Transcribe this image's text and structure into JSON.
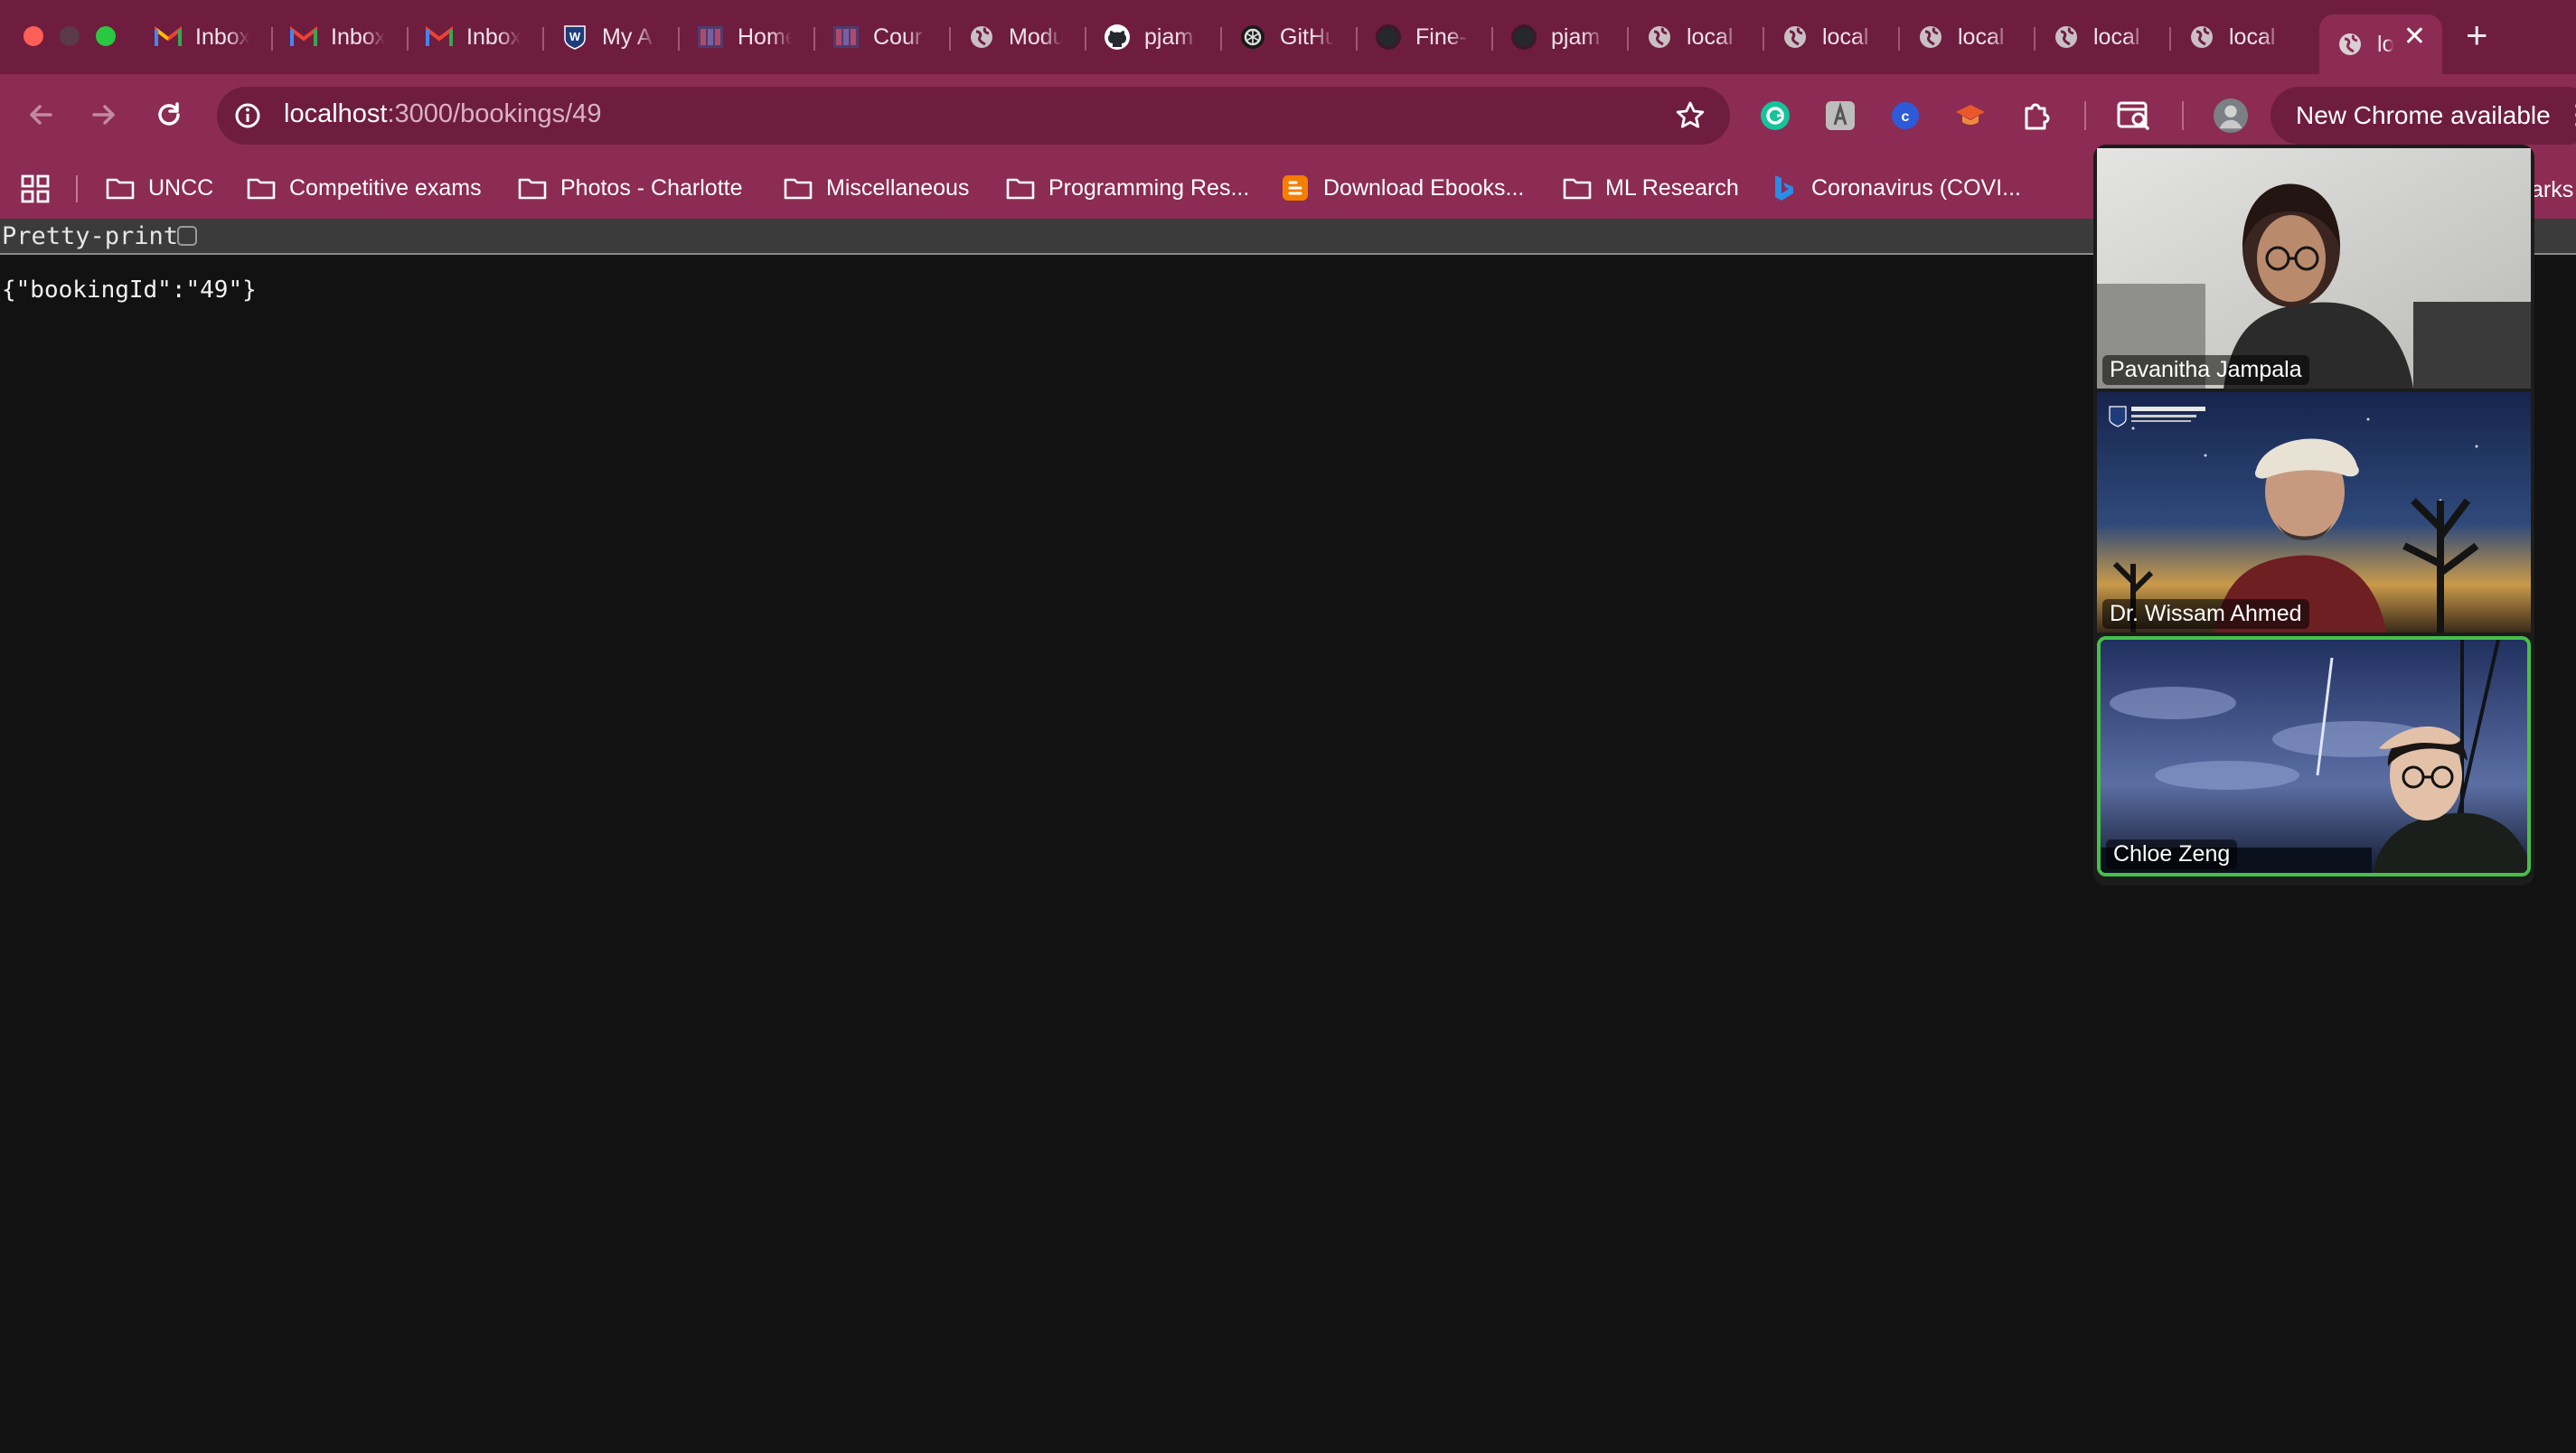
{
  "browser": {
    "tabs": [
      {
        "label": "Inbox",
        "icon": "gmail-icon"
      },
      {
        "label": "Inbox",
        "icon": "gmail-icon"
      },
      {
        "label": "Inbox",
        "icon": "gmail-icon"
      },
      {
        "label": "My A",
        "icon": "westcliff-icon"
      },
      {
        "label": "Home",
        "icon": "canvas-icon"
      },
      {
        "label": "Cour",
        "icon": "canvas-icon"
      },
      {
        "label": "Modu",
        "icon": "globe-icon"
      },
      {
        "label": "pjam",
        "icon": "github-icon"
      },
      {
        "label": "GitHu",
        "icon": "openai-icon"
      },
      {
        "label": "Fine-",
        "icon": "github-icon"
      },
      {
        "label": "pjam",
        "icon": "github-icon"
      },
      {
        "label": "local",
        "icon": "globe-icon"
      },
      {
        "label": "local",
        "icon": "globe-icon"
      },
      {
        "label": "local",
        "icon": "globe-icon"
      },
      {
        "label": "local",
        "icon": "globe-icon"
      },
      {
        "label": "local",
        "icon": "globe-icon"
      },
      {
        "label": "lo",
        "icon": "globe-icon",
        "active": true
      }
    ],
    "new_tab_label": "+",
    "close_tab_label": "✕",
    "address": {
      "host": "localhost",
      "path": ":3000/bookings/49"
    },
    "update_button": "New Chrome available",
    "bookmarks": [
      {
        "label": "UNCC",
        "icon": "folder-icon"
      },
      {
        "label": "Competitive exams",
        "icon": "folder-icon"
      },
      {
        "label": "Photos - Charlotte",
        "icon": "folder-icon"
      },
      {
        "label": "Miscellaneous",
        "icon": "folder-icon"
      },
      {
        "label": "Programming Res...",
        "icon": "folder-icon"
      },
      {
        "label": "Download Ebooks...",
        "icon": "blogger-icon"
      },
      {
        "label": "ML Research",
        "icon": "folder-icon"
      },
      {
        "label": "Coronavirus (COVI...",
        "icon": "bing-icon"
      }
    ],
    "bookmarks_overflow": "arks",
    "colors": {
      "frame": "#6f1d3f",
      "toolbar": "#8c2b53",
      "page_bg": "#121212"
    }
  },
  "page": {
    "pretty_print_label": "Pretty-print",
    "json_text": "{\"bookingId\":\"49\"}"
  },
  "call": {
    "participants": [
      {
        "name": "Pavanitha Jampala"
      },
      {
        "name": "Dr. Wissam Ahmed"
      },
      {
        "name": "Chloe Zeng",
        "speaking": true
      }
    ],
    "speaking_color": "#45c04b"
  }
}
